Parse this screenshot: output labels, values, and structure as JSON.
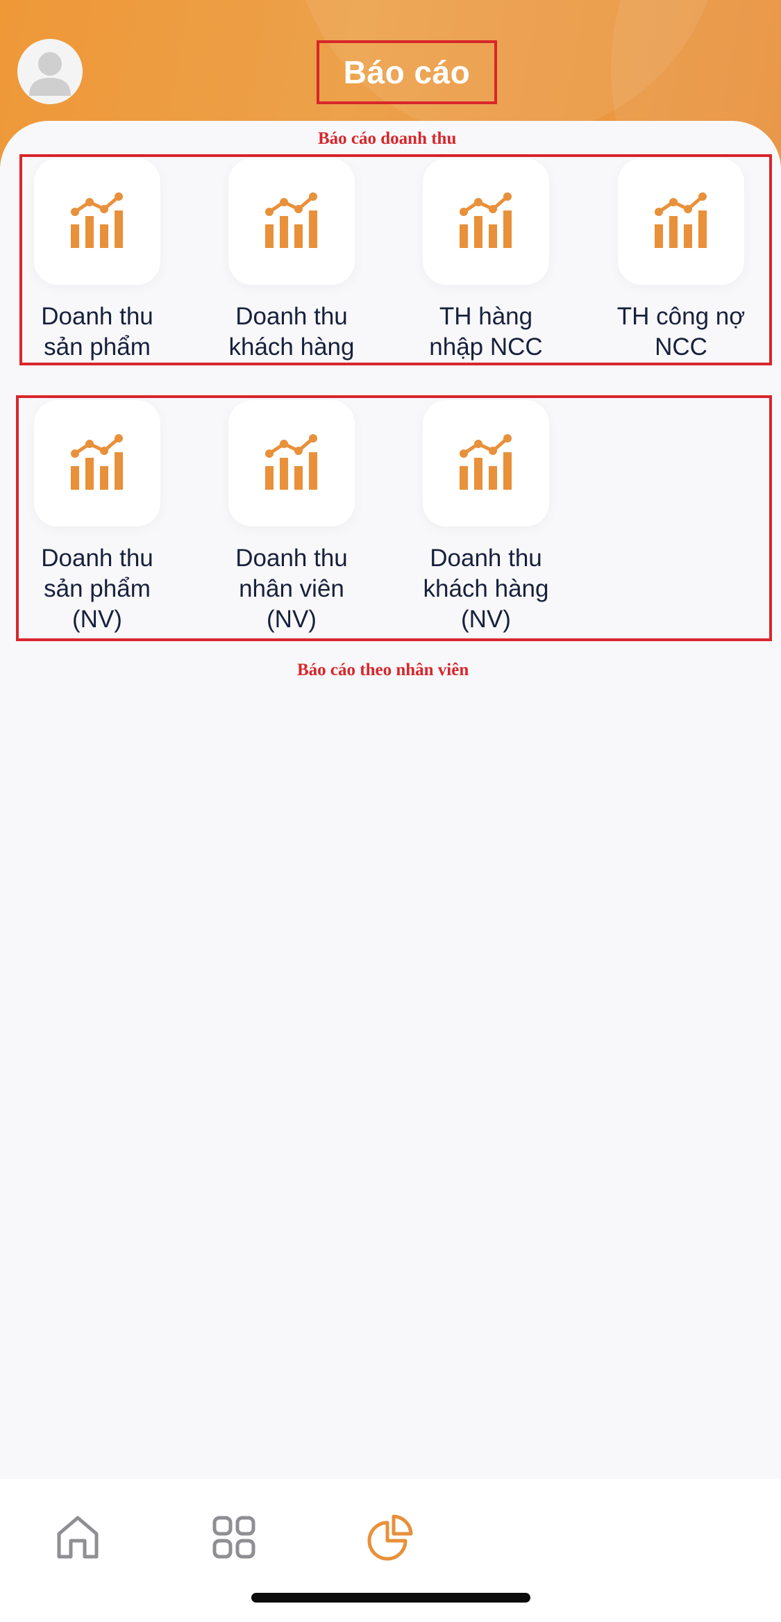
{
  "header": {
    "title": "Báo cáo"
  },
  "annotations": {
    "revenue_group": "Báo cáo doanh thu",
    "employee_group": "Báo cáo theo nhân viên"
  },
  "revenue_reports": [
    {
      "label": "Doanh thu\nsản phẩm",
      "icon": "chart-icon"
    },
    {
      "label": "Doanh thu\nkhách hàng",
      "icon": "chart-icon"
    },
    {
      "label": "TH hàng\nnhập NCC",
      "icon": "chart-icon"
    },
    {
      "label": "TH công nợ\nNCC",
      "icon": "chart-icon"
    }
  ],
  "employee_reports": [
    {
      "label": "Doanh thu\nsản phẩm\n(NV)",
      "icon": "chart-icon"
    },
    {
      "label": "Doanh thu\nnhân viên\n(NV)",
      "icon": "chart-icon"
    },
    {
      "label": "Doanh thu\nkhách hàng\n(NV)",
      "icon": "chart-icon"
    }
  ],
  "bottom_nav": [
    {
      "icon": "home-icon",
      "active": false
    },
    {
      "icon": "grid-icon",
      "active": false
    },
    {
      "icon": "pie-chart-icon",
      "active": true
    }
  ],
  "colors": {
    "accent": "#e8903a",
    "annotation": "#d8262b",
    "text": "#17203c",
    "inactive_icon": "#8e8e93"
  }
}
